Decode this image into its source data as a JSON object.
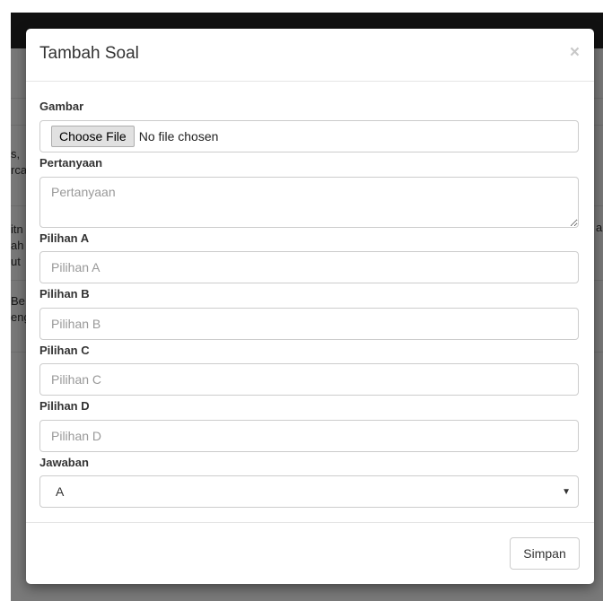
{
  "background": {
    "left_fragments": [
      "s,",
      "rca",
      "itn",
      "ah",
      "ut",
      "Be",
      "eng"
    ],
    "right_fragment": "a"
  },
  "modal": {
    "title": "Tambah Soal",
    "close_symbol": "×",
    "fields": {
      "gambar": {
        "label": "Gambar",
        "button": "Choose File",
        "status": "No file chosen"
      },
      "pertanyaan": {
        "label": "Pertanyaan",
        "placeholder": "Pertanyaan"
      },
      "pilihan_a": {
        "label": "Pilihan A",
        "placeholder": "Pilihan A"
      },
      "pilihan_b": {
        "label": "Pilihan B",
        "placeholder": "Pilihan B"
      },
      "pilihan_c": {
        "label": "Pilihan C",
        "placeholder": "Pilihan C"
      },
      "pilihan_d": {
        "label": "Pilihan D",
        "placeholder": "Pilihan D"
      },
      "jawaban": {
        "label": "Jawaban",
        "value": "A",
        "caret_icon": "caret-down-icon"
      }
    },
    "save_label": "Simpan"
  }
}
